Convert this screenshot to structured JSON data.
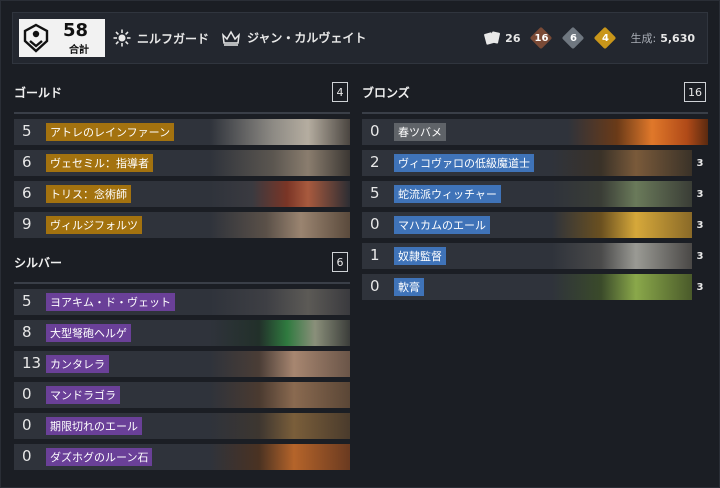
{
  "header": {
    "total_count": "58",
    "total_label": "合計",
    "faction": "ニルフガード",
    "leader": "ジャン・カルヴェイト",
    "card_count": "26",
    "bronze_count": "16",
    "silver_count": "6",
    "gold_count": "4",
    "craft_label": "生成:",
    "craft_cost": "5,630"
  },
  "sections": {
    "gold": {
      "title": "ゴールド",
      "count": "4",
      "cards": [
        {
          "cost": "5",
          "name": "アトレのレインファーン"
        },
        {
          "cost": "6",
          "name": "ヴェセミル：指導者"
        },
        {
          "cost": "6",
          "name": "トリス：念術師"
        },
        {
          "cost": "9",
          "name": "ヴィルジフォルツ"
        }
      ]
    },
    "silver": {
      "title": "シルバー",
      "count": "6",
      "cards": [
        {
          "cost": "5",
          "name": "ヨアキム・ド・ヴェット"
        },
        {
          "cost": "8",
          "name": "大型弩砲ヘルゲ"
        },
        {
          "cost": "13",
          "name": "カンタレラ"
        },
        {
          "cost": "0",
          "name": "マンドラゴラ"
        },
        {
          "cost": "0",
          "name": "期限切れのエール"
        },
        {
          "cost": "0",
          "name": "ダズホグのルーン石"
        }
      ]
    },
    "bronze": {
      "title": "ブロンズ",
      "count": "16",
      "cards": [
        {
          "cost": "0",
          "name": "春ツバメ",
          "copies": ""
        },
        {
          "cost": "2",
          "name": "ヴィコヴァロの低級魔道士",
          "copies": "3"
        },
        {
          "cost": "5",
          "name": "蛇流派ウィッチャー",
          "copies": "3"
        },
        {
          "cost": "0",
          "name": "マハカムのエール",
          "copies": "3"
        },
        {
          "cost": "1",
          "name": "奴隷監督",
          "copies": "3"
        },
        {
          "cost": "0",
          "name": "軟膏",
          "copies": "3"
        }
      ]
    }
  },
  "colors": {
    "gold_tag": "#a3720f",
    "silver_tag": "#6a4098",
    "bronze_tag": "#3f73b8",
    "neutral_tag": "#5f6368"
  }
}
